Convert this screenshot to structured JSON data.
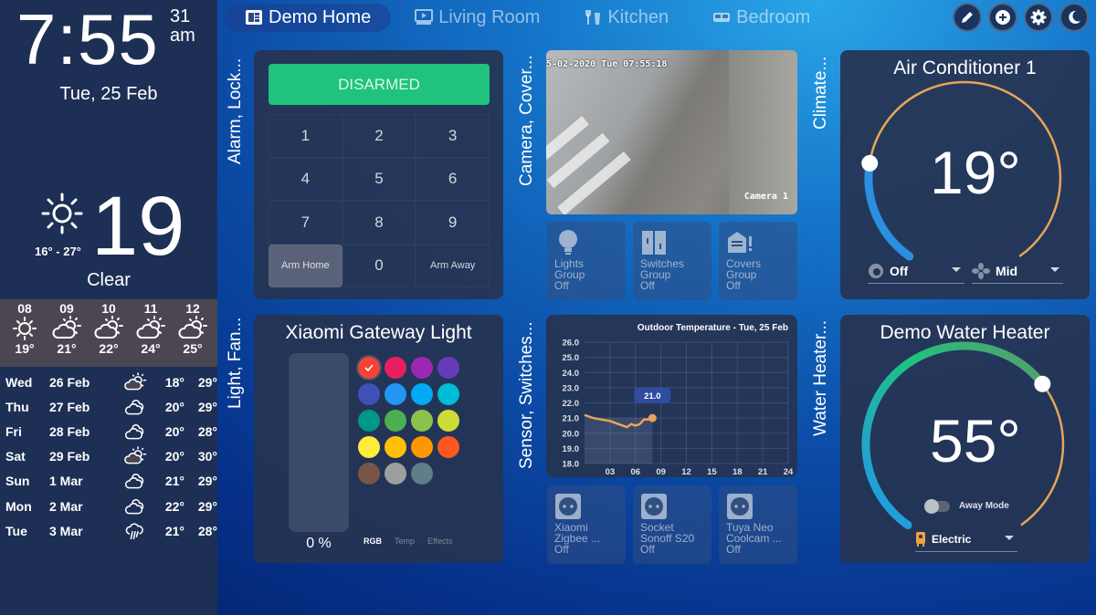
{
  "sidebar": {
    "clock": {
      "time": "7:55",
      "seconds": "31",
      "ampm": "am",
      "date": "Tue, 25 Feb"
    },
    "weather_now": {
      "icon": "sun-icon",
      "temperature": "19",
      "range": "16° - 27°",
      "condition": "Clear"
    },
    "hourly": [
      {
        "hour": "08",
        "icon": "sun-icon",
        "temp": "19°"
      },
      {
        "hour": "09",
        "icon": "partly-cloudy-icon",
        "temp": "21°"
      },
      {
        "hour": "10",
        "icon": "partly-cloudy-icon",
        "temp": "22°"
      },
      {
        "hour": "11",
        "icon": "partly-cloudy-icon",
        "temp": "24°"
      },
      {
        "hour": "12",
        "icon": "partly-cloudy-icon",
        "temp": "25°"
      }
    ],
    "daily": [
      {
        "day": "Wed",
        "date": "26 Feb",
        "icon": "partly-cloudy-icon",
        "low": "18°",
        "high": "29°"
      },
      {
        "day": "Thu",
        "date": "27 Feb",
        "icon": "cloudy-icon",
        "low": "20°",
        "high": "29°"
      },
      {
        "day": "Fri",
        "date": "28 Feb",
        "icon": "cloudy-icon",
        "low": "20°",
        "high": "28°"
      },
      {
        "day": "Sat",
        "date": "29 Feb",
        "icon": "partly-cloudy-icon",
        "low": "20°",
        "high": "30°"
      },
      {
        "day": "Sun",
        "date": "1 Mar",
        "icon": "cloudy-icon",
        "low": "21°",
        "high": "29°"
      },
      {
        "day": "Mon",
        "date": "2 Mar",
        "icon": "cloudy-icon",
        "low": "22°",
        "high": "29°"
      },
      {
        "day": "Tue",
        "date": "3 Mar",
        "icon": "rain-icon",
        "low": "21°",
        "high": "28°"
      }
    ]
  },
  "nav": {
    "tabs": [
      {
        "label": "Demo Home",
        "icon": "dashboard-icon",
        "active": true
      },
      {
        "label": "Living Room",
        "icon": "tv-icon",
        "active": false
      },
      {
        "label": "Kitchen",
        "icon": "utensils-icon",
        "active": false
      },
      {
        "label": "Bedroom",
        "icon": "bed-icon",
        "active": false
      }
    ],
    "buttons": [
      {
        "name": "edit",
        "icon": "pencil-icon"
      },
      {
        "name": "add",
        "icon": "plus-circle-icon"
      },
      {
        "name": "settings",
        "icon": "gear-icon"
      },
      {
        "name": "night-mode",
        "icon": "moon-icon"
      }
    ]
  },
  "sections": {
    "alarm": "Alarm, Lock...",
    "camera": "Camera, Cover...",
    "climate": "Climate...",
    "light": "Light, Fan...",
    "sensor": "Sensor, Switches...",
    "water": "Water Heater..."
  },
  "alarm": {
    "state": "DISARMED",
    "state_color": "#1fc37d",
    "keys": [
      "1",
      "2",
      "3",
      "4",
      "5",
      "6",
      "7",
      "8",
      "9",
      "Arm Home",
      "0",
      "Arm Away"
    ]
  },
  "camera": {
    "timestamp": "5-02-2020 Tue 07:55:18",
    "label": "Camera 1"
  },
  "groups": [
    {
      "line1": "Lights",
      "line2": "Group",
      "state": "Off",
      "icon": "bulb-icon"
    },
    {
      "line1": "Switches",
      "line2": "Group",
      "state": "Off",
      "icon": "switches-icon"
    },
    {
      "line1": "Covers",
      "line2": "Group",
      "state": "Off",
      "icon": "garage-icon"
    }
  ],
  "climate": {
    "title": "Air Conditioner 1",
    "target": "19°",
    "target_fraction": 0.22,
    "mode": "Off",
    "fan": "Mid"
  },
  "light": {
    "title": "Xiaomi Gateway Light",
    "brightness": "0 %",
    "brightness_fraction": 0,
    "colors": [
      "#f44336",
      "#e91e63",
      "#9c27b0",
      "#673ab7",
      "#3f51b5",
      "#2196f3",
      "#03a9f4",
      "#00bcd4",
      "#009688",
      "#4caf50",
      "#8bc34a",
      "#cddc39",
      "#ffeb3b",
      "#ffc107",
      "#ff9800",
      "#ff5722",
      "#795548",
      "#9e9e9e",
      "#607d8b"
    ],
    "selected_index": 0,
    "tabs": [
      "RGB",
      "Temp",
      "Effects"
    ],
    "active_tab": 0
  },
  "sockets": [
    {
      "line1": "Xiaomi",
      "line2": "Zigbee ...",
      "state": "Off"
    },
    {
      "line1": "Socket",
      "line2": "Sonoff S20",
      "state": "Off"
    },
    {
      "line1": "Tuya Neo",
      "line2": "Coolcam ...",
      "state": "Off"
    }
  ],
  "water_heater": {
    "title": "Demo Water Heater",
    "target": "55°",
    "target_fraction": 0.68,
    "away_label": "Away Mode",
    "away_on": false,
    "operation": "Electric"
  },
  "chart_data": {
    "type": "line",
    "title": "Outdoor Temperature - Tue, 25 Feb",
    "xlabel": "",
    "ylabel": "",
    "x_ticks": [
      "03",
      "06",
      "09",
      "12",
      "15",
      "18",
      "21",
      "24"
    ],
    "y_ticks": [
      "18.0",
      "19.0",
      "20.0",
      "21.0",
      "22.0",
      "23.0",
      "24.0",
      "25.0",
      "26.0"
    ],
    "xlim": [
      0,
      24
    ],
    "ylim": [
      18,
      26
    ],
    "grid": true,
    "series": [
      {
        "name": "Outdoor Temperature",
        "x": [
          0,
          1,
          2,
          3,
          4,
          5,
          5.5,
          6,
          6.5,
          7,
          7.5,
          8
        ],
        "y": [
          21.2,
          21.0,
          20.9,
          20.8,
          20.6,
          20.4,
          20.6,
          20.5,
          20.6,
          20.9,
          20.9,
          21.0
        ]
      }
    ],
    "tooltip": "21.0",
    "line_color": "#e8a45a"
  }
}
